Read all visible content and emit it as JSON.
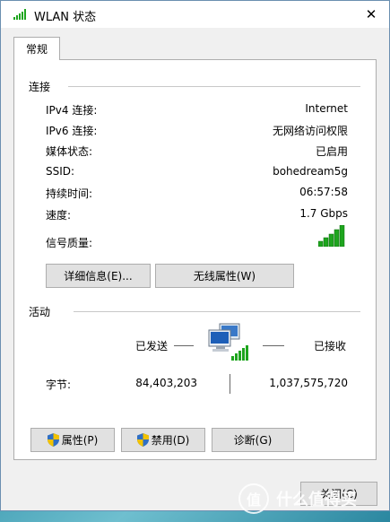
{
  "window": {
    "title": "WLAN 状态",
    "close_glyph": "✕"
  },
  "tabs": [
    {
      "label": "常规"
    }
  ],
  "connection": {
    "group_title": "连接",
    "rows": [
      {
        "label": "IPv4 连接:",
        "value": "Internet"
      },
      {
        "label": "IPv6 连接:",
        "value": "无网络访问权限"
      },
      {
        "label": "媒体状态:",
        "value": "已启用"
      },
      {
        "label": "SSID:",
        "value": "bohedream5g"
      },
      {
        "label": "持续时间:",
        "value": "06:57:58"
      },
      {
        "label": "速度:",
        "value": "1.7 Gbps"
      }
    ],
    "signal_label": "信号质量:",
    "signal_bars": 5,
    "signal_max": 5,
    "details_button": "详细信息(E)...",
    "wireless_button": "无线属性(W)"
  },
  "activity": {
    "group_title": "活动",
    "sent_label": "已发送",
    "received_label": "已接收",
    "bytes_label": "字节:",
    "bytes_sent": "84,403,203",
    "bytes_received": "1,037,575,720"
  },
  "buttons": {
    "properties": "属性(P)",
    "disable": "禁用(D)",
    "diagnose": "诊断(G)",
    "close": "关闭(C)"
  },
  "watermark": {
    "text": "什么值得买",
    "glyph": "值"
  },
  "colors": {
    "signal_green": "#1ea51e",
    "shield_blue": "#2f6fc4",
    "shield_yellow": "#f2c200",
    "window_border": "#6b8fb0"
  }
}
